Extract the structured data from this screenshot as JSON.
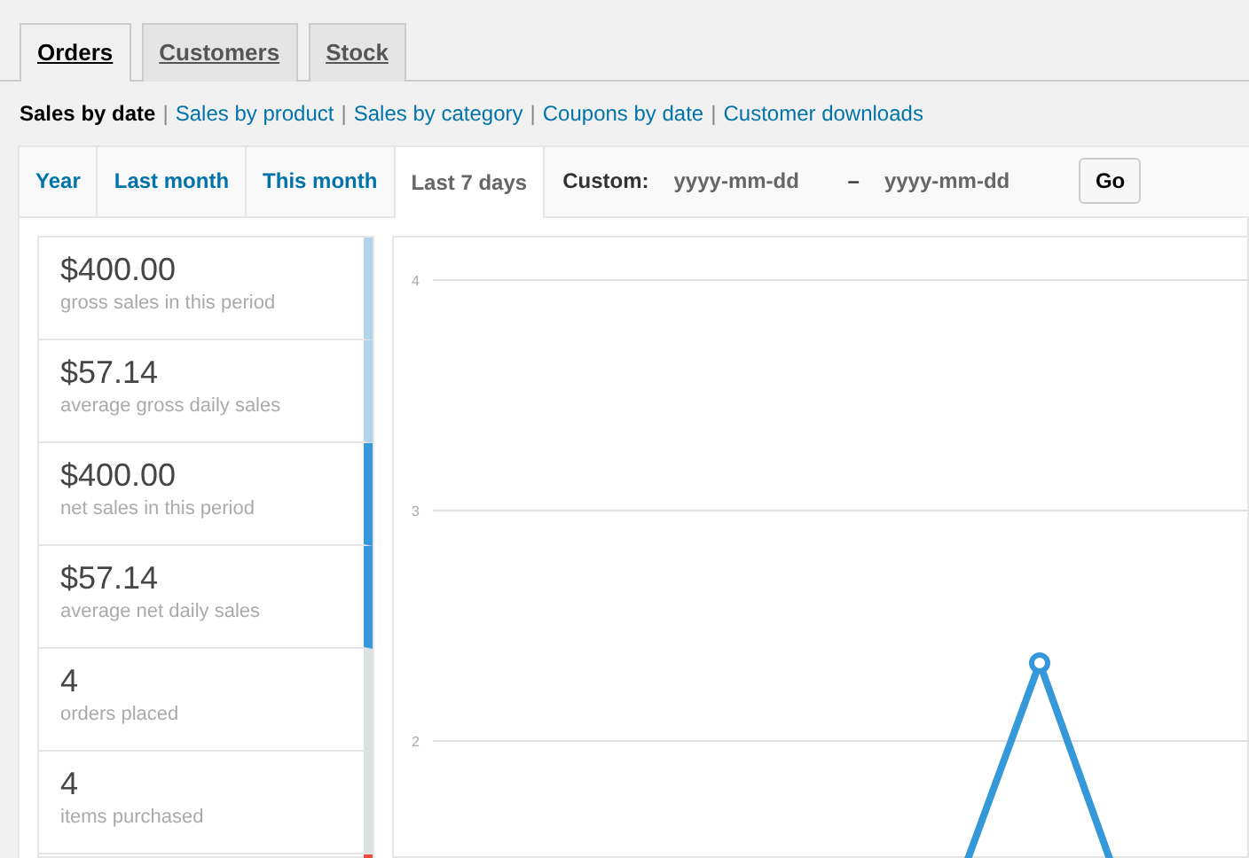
{
  "tabs": [
    {
      "label": "Orders",
      "selected": true
    },
    {
      "label": "Customers",
      "selected": false
    },
    {
      "label": "Stock",
      "selected": false
    }
  ],
  "report_links": [
    {
      "label": "Sales by date",
      "selected": true
    },
    {
      "separator": "|",
      "label": "Sales by product",
      "selected": false
    },
    {
      "separator": "|",
      "label": "Sales by category",
      "selected": false
    },
    {
      "separator": "|",
      "label": "Coupons by date",
      "selected": false
    },
    {
      "separator": "|",
      "label": "Customer downloads",
      "selected": false
    }
  ],
  "ranges": [
    {
      "label": "Year",
      "selected": false
    },
    {
      "label": "Last month",
      "selected": false
    },
    {
      "label": "This month",
      "selected": false
    },
    {
      "label": "Last 7 days",
      "selected": true
    }
  ],
  "custom": {
    "label": "Custom:",
    "from_placeholder": "yyyy-mm-dd",
    "separator": "–",
    "to_placeholder": "yyyy-mm-dd",
    "button": "Go"
  },
  "legend": [
    {
      "value": "$400.00",
      "label": "gross sales in this period",
      "color": "#b1d4ea"
    },
    {
      "value": "$57.14",
      "label": "average gross daily sales",
      "color": "#b1d4ea"
    },
    {
      "value": "$400.00",
      "label": "net sales in this period",
      "color": "#3498db"
    },
    {
      "value": "$57.14",
      "label": "average net daily sales",
      "color": "#3498db"
    },
    {
      "value": "4",
      "label": "orders placed",
      "color": "#dbe1e3"
    },
    {
      "value": "4",
      "label": "items purchased",
      "color": "#dbe1e3"
    },
    {
      "color": "#e74c3c"
    }
  ],
  "chart": {
    "y_tick_labels": [
      "4",
      "3",
      "2"
    ]
  }
}
